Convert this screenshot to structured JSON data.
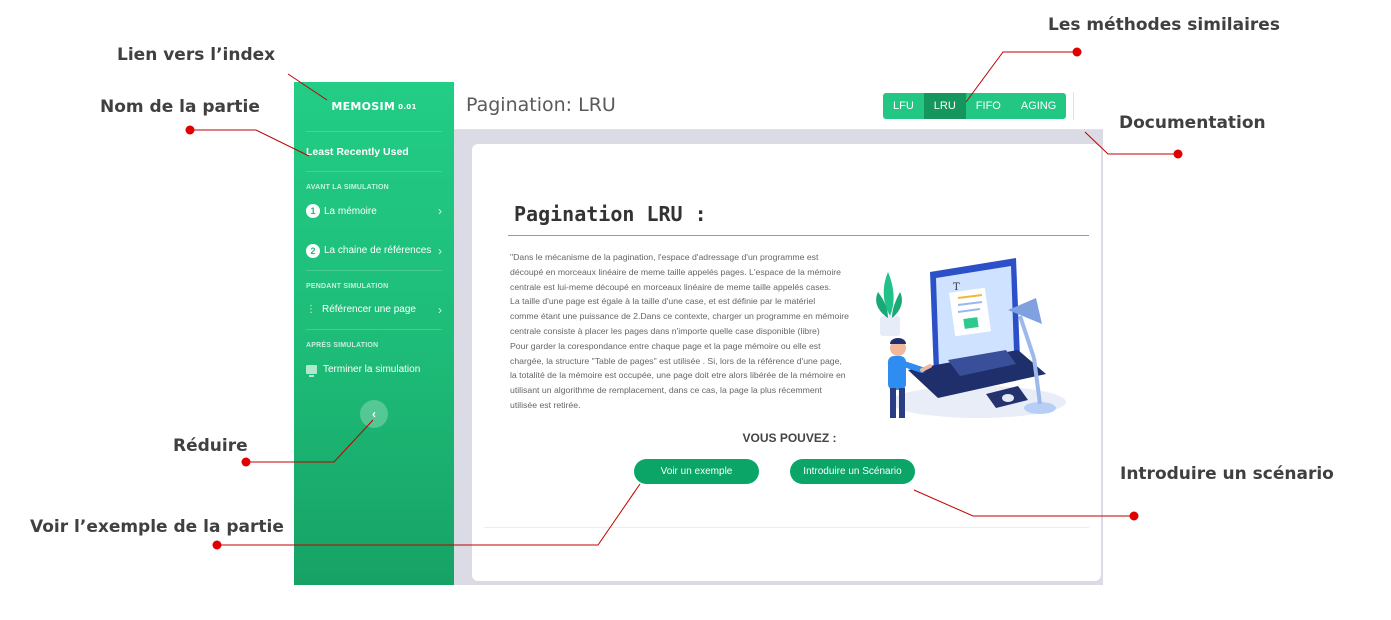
{
  "annotations": {
    "link_index": "Lien vers l’index",
    "part_name": "Nom de la partie",
    "similar_methods": "Les méthodes similaires",
    "documentation": "Documentation",
    "reduce": "Réduire",
    "introduce_scenario": "Introduire un scénario",
    "see_example": "Voir l’exemple de la partie",
    "marker_color": "#e00000",
    "line_color": "#c00000"
  },
  "sidebar": {
    "brand": "MEMOSIM",
    "version": "0.01",
    "part_name": "Least Recently Used",
    "sections": [
      {
        "title": "AVANT LA SIMULATION",
        "items": [
          {
            "number": "1",
            "label": "La mémoire"
          },
          {
            "number": "2",
            "label": "La chaine de références"
          }
        ]
      },
      {
        "title": "PENDANT SIMULATION",
        "items": [
          {
            "label": "Référencer une page"
          }
        ]
      },
      {
        "title": "APRÈS SIMULATION",
        "items": [
          {
            "label": "Terminer la simulation"
          }
        ]
      }
    ],
    "collapse_icon": "chevron-left-icon",
    "colors": {
      "top": "#22cd85",
      "bottom": "#17a265"
    }
  },
  "topbar": {
    "title": "Pagination: LRU",
    "methods": [
      {
        "label": "LFU",
        "active": false
      },
      {
        "label": "LRU",
        "active": true
      },
      {
        "label": "FIFO",
        "active": false
      },
      {
        "label": "AGING",
        "active": false
      }
    ],
    "doc_icon": "vertical-dots-icon",
    "colors": {
      "method": "#22c784",
      "method_active": "#15965c"
    }
  },
  "content": {
    "title": "Pagination LRU :",
    "description_lines": [
      "\"Dans le mécanisme de la pagination, l'espace d'adressage d'un programme est",
      "découpé en morceaux linéaire de meme taille appelés pages. L'espace de la mémoire",
      "centrale est lui-meme découpé en morceaux linéaire de meme taille appelés cases.",
      "La taille d'une page est égale à la taille d'une case, et est définie par le matériel",
      "comme étant une puissance de 2.Dans ce contexte, charger un programme en mémoire",
      "centrale consiste à placer les pages dans n'importe quelle case disponible (libre)",
      "Pour garder la corespondance entre chaque page et la page mémoire ou elle est",
      "chargée, la structure \"Table de pages\" est utilisée . Si, lors de la référence d'une page,",
      "la totalité de la mémoire est occupée, une page doit etre alors libérée de la mémoire en",
      "utilisant un algorithme de remplacement, dans ce cas, la page la plus récemment",
      "utilisée est retirée."
    ],
    "vous_pouvez": "VOUS POUVEZ :",
    "buttons": {
      "example": "Voir un exemple",
      "scenario": "Introduire un Scénario"
    },
    "illustration_icon": "developer-laptop-illustration",
    "button_color": "#0aa567"
  }
}
